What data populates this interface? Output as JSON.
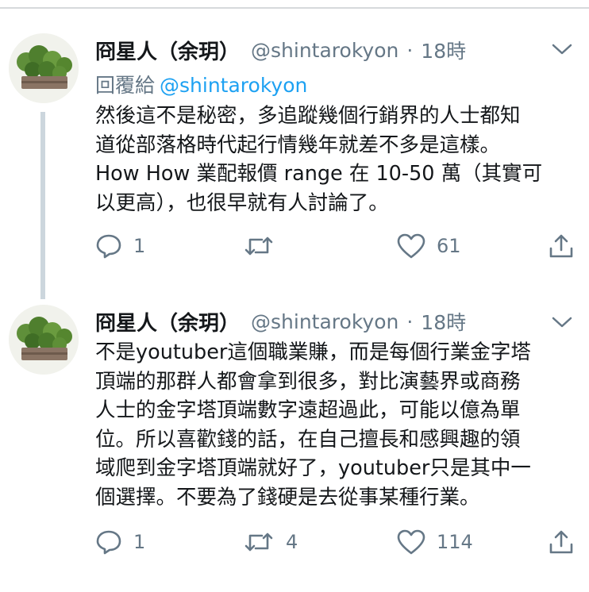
{
  "tweets": [
    {
      "name": "冏星人（余玥）",
      "handle": "@shintarokyon",
      "dot": "·",
      "time": "18時",
      "reply_prefix": "回覆給",
      "reply_handle": "@shintarokyon",
      "lines": [
        "然後這不是秘密，多追蹤幾個行銷界的人士都知",
        "道從部落格時代起行情幾年就差不多是這樣。",
        "How How 業配報價 range 在 10-50 萬（其實可",
        "以更高），也很早就有人討論了。"
      ],
      "reply_count": "1",
      "retweet_count": "",
      "like_count": "61"
    },
    {
      "name": "冏星人（余玥）",
      "handle": "@shintarokyon",
      "dot": "·",
      "time": "18時",
      "lines": [
        "不是youtuber這個職業賺，而是每個行業金字塔",
        "頂端的那群人都會拿到很多，對比演藝界或商務",
        "人士的金字塔頂端數字遠超過此，可能以億為單",
        "位。所以喜歡錢的話，在自己擅長和感興趣的領",
        "域爬到金字塔頂端就好了，youtuber只是其中一",
        "個選擇。不要為了錢硬是去從事某種行業。"
      ],
      "reply_count": "1",
      "retweet_count": "4",
      "like_count": "114"
    }
  ],
  "colors": {
    "text": "#14171a",
    "secondary": "#657786",
    "link": "#1da1f2",
    "thread_line": "#ccd6dd"
  },
  "icons": [
    "reply-icon",
    "retweet-icon",
    "like-icon",
    "share-icon",
    "chevron-down-icon"
  ]
}
